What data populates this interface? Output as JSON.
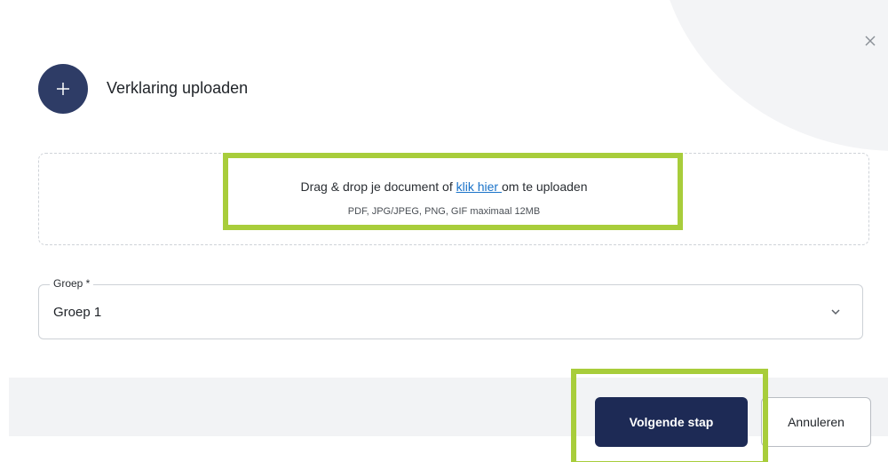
{
  "dialog": {
    "title": "Verklaring uploaden",
    "icons": {
      "add": "plus-icon",
      "close": "close-icon",
      "select": "chevron-down-icon"
    }
  },
  "dropzone": {
    "text_before": "Drag & drop je document of ",
    "link_text": "klik hier ",
    "text_after": "om te uploaden",
    "formats": "PDF, JPG/JPEG, PNG, GIF maximaal 12MB"
  },
  "group_select": {
    "label": "Groep *",
    "value": "Groep 1"
  },
  "footer": {
    "next_label": "Volgende stap",
    "cancel_label": "Annuleren"
  },
  "colors": {
    "primary": "#1d2a55",
    "icon_bg": "#2e3c66",
    "link": "#1a73c9",
    "highlight": "#a8cd3b"
  }
}
